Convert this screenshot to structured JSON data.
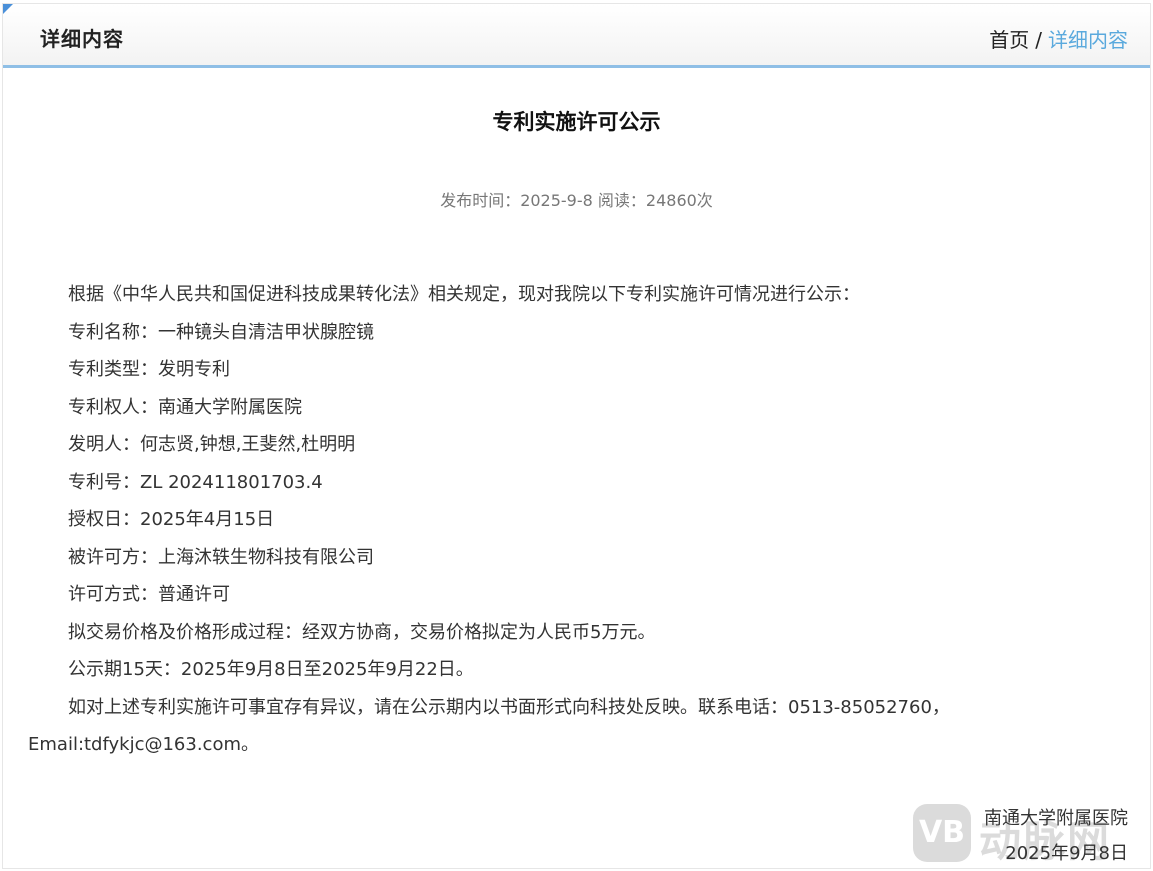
{
  "header": {
    "title": "详细内容",
    "breadcrumb": {
      "home": "首页",
      "separator": "/",
      "current": "详细内容"
    }
  },
  "article": {
    "title": "专利实施许可公示",
    "meta": "发布时间：2025-9-8 阅读：24860次",
    "paragraphs": [
      "根据《中华人民共和国促进科技成果转化法》相关规定，现对我院以下专利实施许可情况进行公示：",
      "专利名称：一种镜头自清洁甲状腺腔镜",
      "专利类型：发明专利",
      "专利权人：南通大学附属医院",
      "发明人：何志贤,钟想,王斐然,杜明明",
      "专利号：ZL 202411801703.4",
      "授权日：2025年4月15日",
      "被许可方：上海沐轶生物科技有限公司",
      "许可方式：普通许可",
      "拟交易价格及价格形成过程：经双方协商，交易价格拟定为人民币5万元。",
      "公示期15天：2025年9月8日至2025年9月22日。",
      "如对上述专利实施许可事宜存有异议，请在公示期内以书面形式向科技处反映。联系电话：0513-85052760，Email:tdfykjc@163.com。"
    ],
    "signature": {
      "org": "南通大学附属医院",
      "date": "2025年9月8日"
    }
  },
  "watermark": {
    "badge": "VB",
    "text": "动脉网"
  },
  "colors": {
    "accent": "#5aa9dd",
    "header_border": "#8fbfe6",
    "corner": "#4a90d9"
  }
}
